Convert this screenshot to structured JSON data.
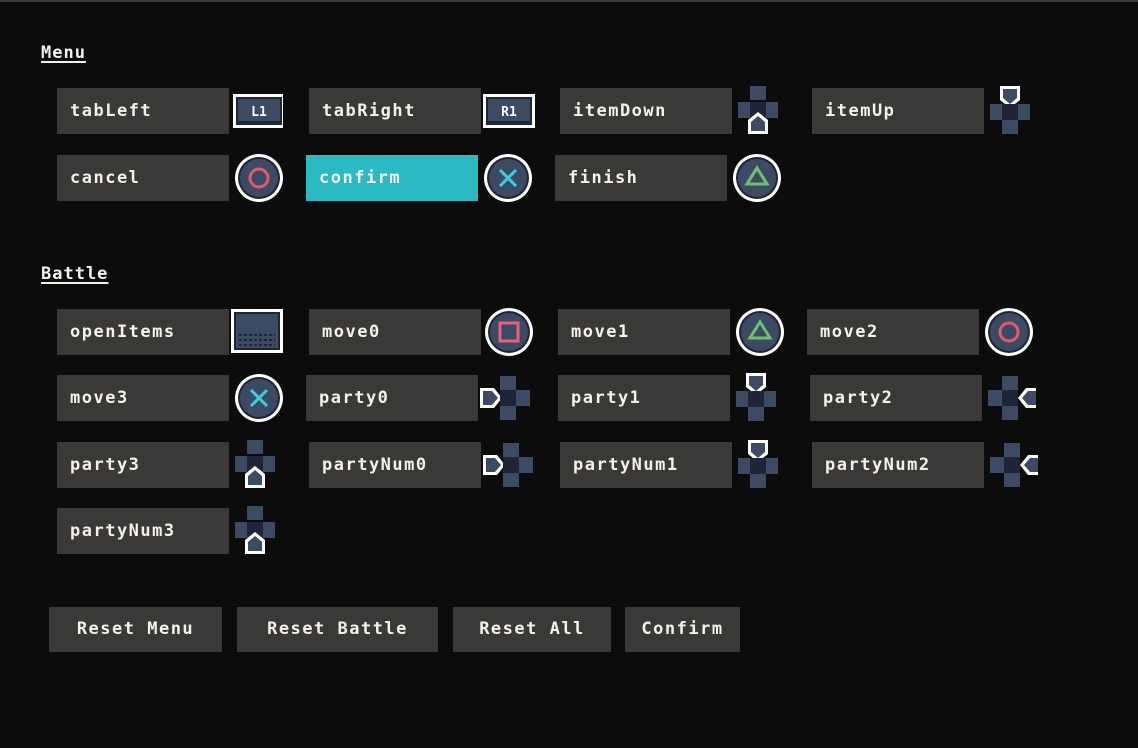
{
  "sections": {
    "menu": {
      "title": "Menu",
      "bindings": [
        {
          "action": "tabLeft",
          "icon": "l1-button-icon"
        },
        {
          "action": "tabRight",
          "icon": "r1-button-icon"
        },
        {
          "action": "itemDown",
          "icon": "dpad-down-icon"
        },
        {
          "action": "itemUp",
          "icon": "dpad-up-icon"
        },
        {
          "action": "cancel",
          "icon": "circle-button-icon"
        },
        {
          "action": "confirm",
          "icon": "cross-button-icon",
          "selected": true
        },
        {
          "action": "finish",
          "icon": "triangle-button-icon"
        }
      ]
    },
    "battle": {
      "title": "Battle",
      "bindings": [
        {
          "action": "openItems",
          "icon": "touchpad-icon"
        },
        {
          "action": "move0",
          "icon": "square-button-icon"
        },
        {
          "action": "move1",
          "icon": "triangle-button-icon"
        },
        {
          "action": "move2",
          "icon": "circle-button-icon"
        },
        {
          "action": "move3",
          "icon": "cross-button-icon"
        },
        {
          "action": "party0",
          "icon": "dpad-left-icon"
        },
        {
          "action": "party1",
          "icon": "dpad-up-icon"
        },
        {
          "action": "party2",
          "icon": "dpad-right-icon"
        },
        {
          "action": "party3",
          "icon": "dpad-down-icon"
        },
        {
          "action": "partyNum0",
          "icon": "dpad-left-icon"
        },
        {
          "action": "partyNum1",
          "icon": "dpad-up-icon"
        },
        {
          "action": "partyNum2",
          "icon": "dpad-right-icon"
        },
        {
          "action": "partyNum3",
          "icon": "dpad-down-icon"
        }
      ]
    }
  },
  "buttons": {
    "reset_menu": "Reset Menu",
    "reset_battle": "Reset Battle",
    "reset_all": "Reset All",
    "confirm": "Confirm"
  },
  "colors": {
    "background": "#0d0c0c",
    "row": "#3a3938",
    "selected": "#2bbac4",
    "icon_fill": "#3d4a63",
    "icon_dark": "#1e2536",
    "circle": "#e05a6a",
    "cross": "#3ccfe0",
    "triangle": "#6fbf73",
    "square": "#e8607c"
  }
}
